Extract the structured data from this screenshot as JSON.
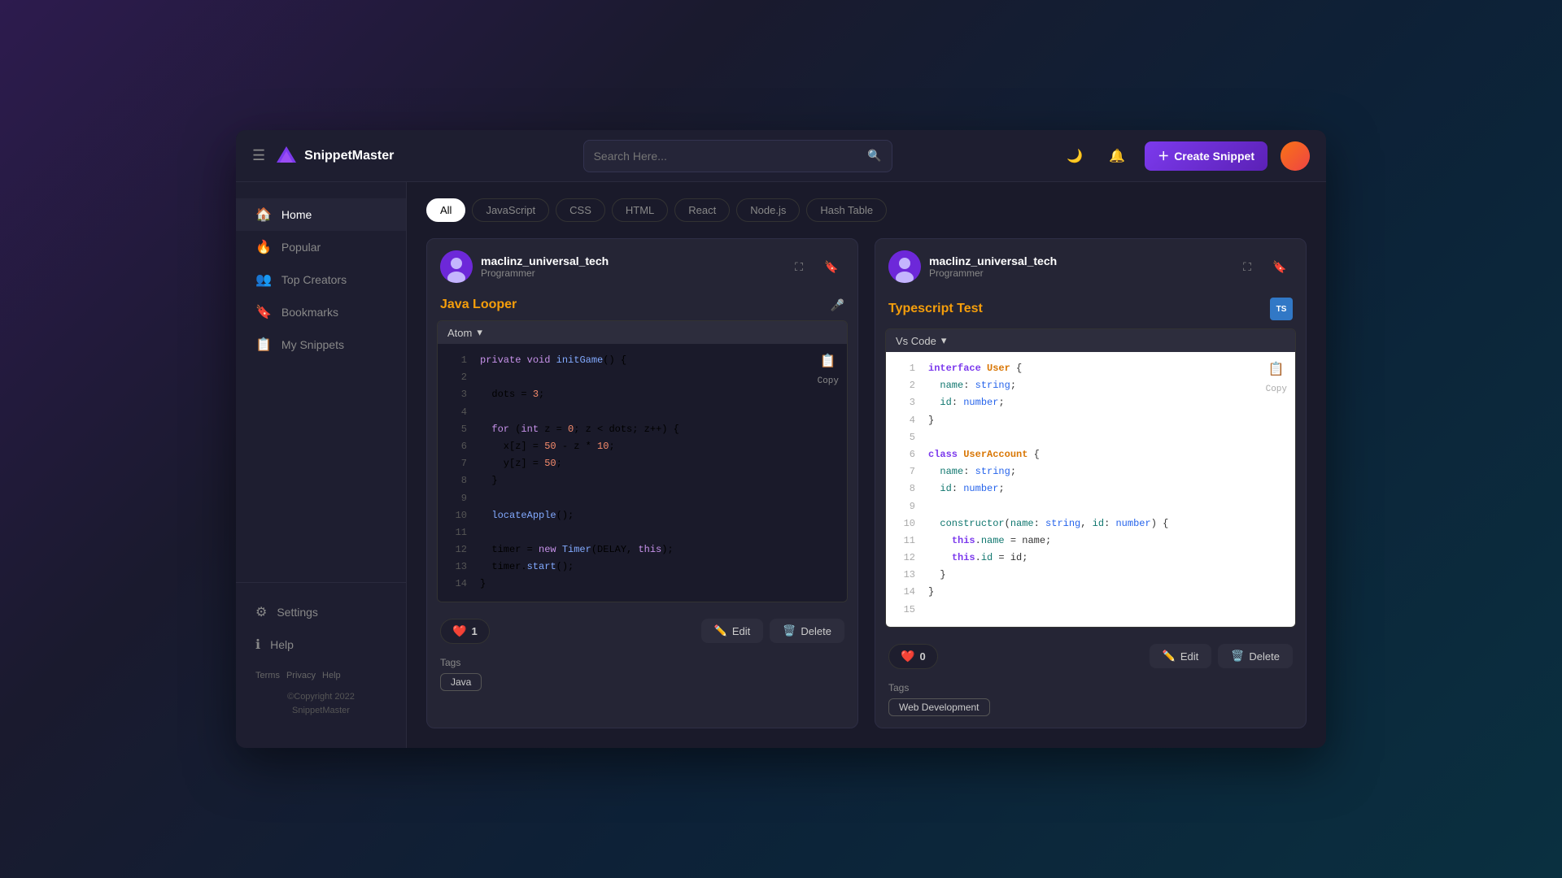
{
  "app": {
    "name": "SnippetMaster",
    "search_placeholder": "Search Here..."
  },
  "header": {
    "create_btn": "Create Snippet",
    "theme_icon": "🌙",
    "bell_icon": "🔔"
  },
  "sidebar": {
    "nav_items": [
      {
        "id": "home",
        "label": "Home",
        "icon": "⌂",
        "active": true
      },
      {
        "id": "popular",
        "label": "Popular",
        "icon": "🔥",
        "active": false
      },
      {
        "id": "top-creators",
        "label": "Top Creators",
        "icon": "👥",
        "active": false
      },
      {
        "id": "bookmarks",
        "label": "Bookmarks",
        "icon": "🔖",
        "active": false
      },
      {
        "id": "my-snippets",
        "label": "My Snippets",
        "icon": "📋",
        "active": false
      }
    ],
    "bottom_items": [
      {
        "id": "settings",
        "label": "Settings",
        "icon": "⚙"
      },
      {
        "id": "help",
        "label": "Help",
        "icon": "ℹ"
      }
    ],
    "footer_links": [
      "Terms",
      "Privacy",
      "Help"
    ],
    "copyright": "©Copyright 2022\nSnippetMaster"
  },
  "filters": {
    "tabs": [
      {
        "id": "all",
        "label": "All",
        "active": true
      },
      {
        "id": "javascript",
        "label": "JavaScript",
        "active": false
      },
      {
        "id": "css",
        "label": "CSS",
        "active": false
      },
      {
        "id": "html",
        "label": "HTML",
        "active": false
      },
      {
        "id": "react",
        "label": "React",
        "active": false
      },
      {
        "id": "nodejs",
        "label": "Node.js",
        "active": false
      },
      {
        "id": "hashtable",
        "label": "Hash Table",
        "active": false
      }
    ]
  },
  "snippets": [
    {
      "id": "snippet-1",
      "username": "maclinz_universal_tech",
      "role": "Programmer",
      "title": "Java Looper",
      "title_color": "#f59e0b",
      "theme": "Atom",
      "likes": 1,
      "tags": [
        "Java"
      ],
      "lang_badge": null,
      "bookmarked": true,
      "code_dark": true,
      "lines": [
        {
          "num": 1,
          "code": "<span class='kw-purple'>private</span> <span class='kw-purple'>void</span> <span class='kw-blue'>initGame</span>() {"
        },
        {
          "num": 2,
          "code": ""
        },
        {
          "num": 3,
          "code": "  dots = <span class='kw-orange'>3</span>;"
        },
        {
          "num": 4,
          "code": ""
        },
        {
          "num": 5,
          "code": "  <span class='kw-purple'>for</span> (<span class='kw-purple'>int</span> z = <span class='kw-orange'>0</span>; z &lt; dots; z++) {"
        },
        {
          "num": 6,
          "code": "    x[z] = <span class='kw-orange'>50</span> - z * <span class='kw-orange'>10</span>;"
        },
        {
          "num": 7,
          "code": "    y[z] = <span class='kw-orange'>50</span>;"
        },
        {
          "num": 8,
          "code": "  }"
        },
        {
          "num": 9,
          "code": ""
        },
        {
          "num": 10,
          "code": "  <span class='kw-blue'>locateApple</span>();"
        },
        {
          "num": 11,
          "code": ""
        },
        {
          "num": 12,
          "code": "  timer = <span class='kw-purple'>new</span> <span class='kw-blue'>Timer</span>(DELAY, <span class='kw-purple'>this</span>);"
        },
        {
          "num": 13,
          "code": "  timer.<span class='kw-blue'>start</span>();"
        },
        {
          "num": 14,
          "code": "}"
        }
      ]
    },
    {
      "id": "snippet-2",
      "username": "maclinz_universal_tech",
      "role": "Programmer",
      "title": "Typescript Test",
      "title_color": "#f59e0b",
      "theme": "Vs Code",
      "likes": 0,
      "tags": [
        "Web Development"
      ],
      "lang_badge": "TS",
      "bookmarked": true,
      "code_dark": false,
      "lines": [
        {
          "num": 1,
          "code": "<span class='ts-kw'>interface</span> <span class='ts-class'>User</span> {"
        },
        {
          "num": 2,
          "code": "  <span class='ts-prop'>name</span>: <span class='ts-type'>string</span>;"
        },
        {
          "num": 3,
          "code": "  <span class='ts-prop'>id</span>: <span class='ts-type'>number</span>;"
        },
        {
          "num": 4,
          "code": "}"
        },
        {
          "num": 5,
          "code": ""
        },
        {
          "num": 6,
          "code": "<span class='ts-kw'>class</span> <span class='ts-class'>UserAccount</span> {"
        },
        {
          "num": 7,
          "code": "  <span class='ts-prop'>name</span>: <span class='ts-type'>string</span>;"
        },
        {
          "num": 8,
          "code": "  <span class='ts-prop'>id</span>: <span class='ts-type'>number</span>;"
        },
        {
          "num": 9,
          "code": ""
        },
        {
          "num": 10,
          "code": "  <span class='ts-prop'>constructor</span>(<span class='ts-prop'>name</span>: <span class='ts-type'>string</span>, <span class='ts-prop'>id</span>: <span class='ts-type'>number</span>) {"
        },
        {
          "num": 11,
          "code": "    <span class='ts-kw'>this</span>.<span class='ts-prop'>name</span> = name;"
        },
        {
          "num": 12,
          "code": "    <span class='ts-kw'>this</span>.<span class='ts-prop'>id</span> = id;"
        },
        {
          "num": 13,
          "code": "  }"
        },
        {
          "num": 14,
          "code": "}"
        },
        {
          "num": 15,
          "code": ""
        }
      ]
    }
  ],
  "buttons": {
    "edit": "Edit",
    "delete": "Delete",
    "copy": "Copy"
  }
}
